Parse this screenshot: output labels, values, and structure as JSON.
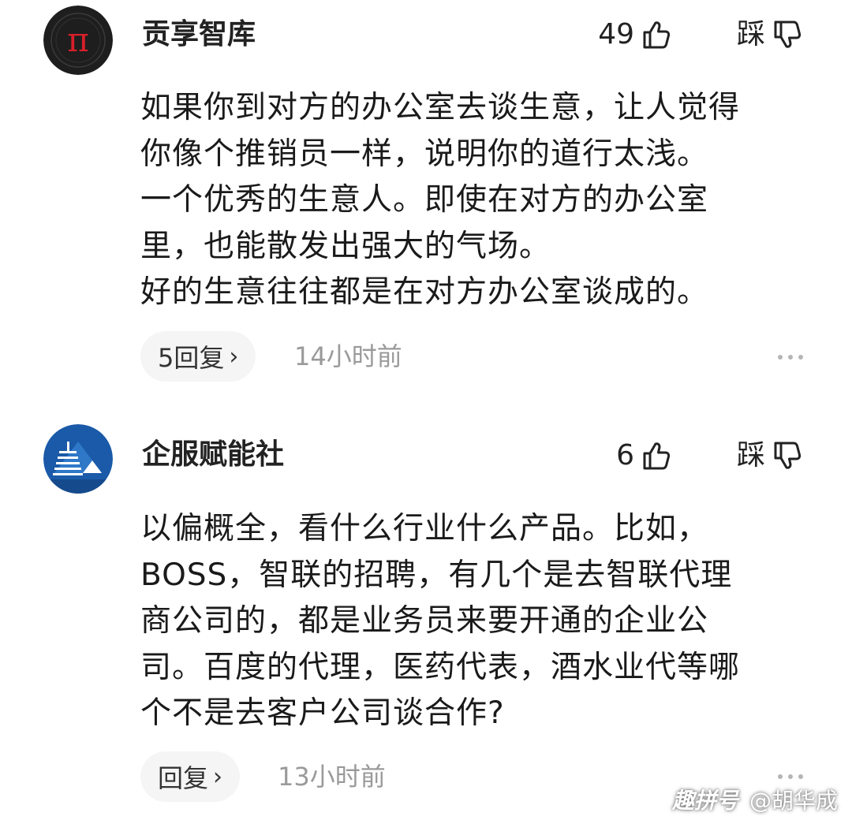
{
  "comments": [
    {
      "username": "贡享智库",
      "likes": "49",
      "dislike_label": "踩",
      "body_lines": [
        "如果你到对方的办公室去谈生意，让人觉得",
        "你像个推销员一样，说明你的道行太浅。",
        "一个优秀的生意人。即使在对方的办公室",
        "里，也能散发出强大的气场。",
        "好的生意往往都是在对方办公室谈成的。"
      ],
      "reply_label": "5回复",
      "time": "14小时前",
      "avatar_glyph": "π",
      "avatar_icon": "pi-symbol-avatar",
      "avatar_colors": {
        "bg": "#1e1e1e",
        "ring": "#3a3a3a",
        "glyph": "#d8202a"
      }
    },
    {
      "username": "企服赋能社",
      "likes": "6",
      "dislike_label": "踩",
      "body_lines": [
        "以偏概全，看什么行业什么产品。比如，",
        "BOSS，智联的招聘，有几个是去智联代理",
        "商公司的，都是业务员来要开通的企业公",
        "司。百度的代理，医药代表，酒水业代等哪",
        "个不是去客户公司谈合作?"
      ],
      "reply_label": "回复",
      "time": "13小时前",
      "avatar_icon": "building-logo-avatar",
      "avatar_colors": {
        "bg": "#1a5aa8",
        "accent": "#ffffff"
      }
    }
  ],
  "icons": {
    "like": "thumbs-up-outline-icon",
    "dislike": "thumbs-down-outline-icon",
    "chevron": "chevron-right-icon",
    "more": "more-dots-icon"
  },
  "watermark": {
    "brand": "趣拼号",
    "handle": "@胡华成"
  },
  "colors": {
    "text_primary": "#1a1a1a",
    "text_secondary": "#9a9a9a",
    "pill_bg": "#f5f5f5",
    "icon_stroke": "#222222"
  }
}
